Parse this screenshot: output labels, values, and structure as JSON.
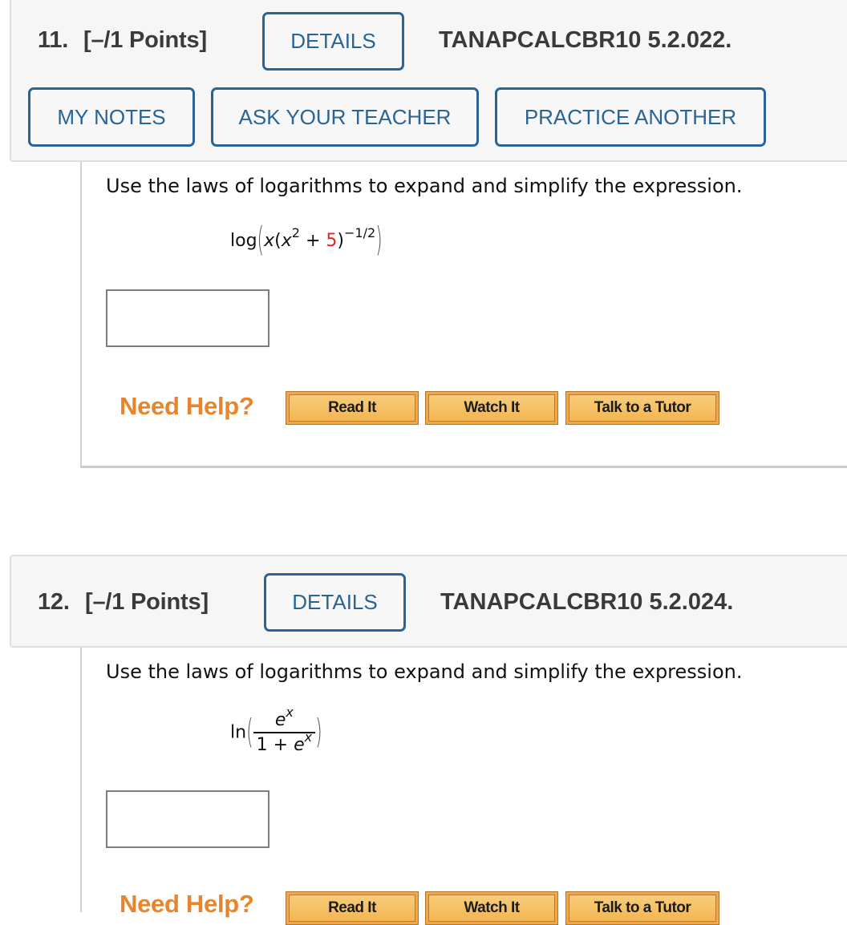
{
  "questions": [
    {
      "number": "11.",
      "points": "[–/1 Points]",
      "details_label": "DETAILS",
      "code": "TANAPCALCBR10 5.2.022.",
      "actions": [
        "MY NOTES",
        "ASK YOUR TEACHER",
        "PRACTICE ANOTHER"
      ],
      "prompt": "Use the laws of logarithms to expand and simplify the expression.",
      "expression": {
        "func": "log",
        "x": "x",
        "open": "(",
        "base": "x",
        "exponent": "2",
        "plus": "+",
        "constant": "5",
        "close": ")",
        "outer_exponent": "−1/2"
      },
      "answer_value": "",
      "help": {
        "label": "Need Help?",
        "buttons": [
          "Read It",
          "Watch It",
          "Talk to a Tutor"
        ]
      }
    },
    {
      "number": "12.",
      "points": "[–/1 Points]",
      "details_label": "DETAILS",
      "code": "TANAPCALCBR10 5.2.024.",
      "prompt": "Use the laws of logarithms to expand and simplify the expression.",
      "expression": {
        "func": "ln",
        "numerator_base": "e",
        "numerator_exp": "x",
        "denominator_one": "1 + ",
        "denominator_base": "e",
        "denominator_exp": "x"
      },
      "answer_value": "",
      "help": {
        "label": "Need Help?",
        "buttons": [
          "Read It",
          "Watch It",
          "Talk to a Tutor"
        ]
      }
    }
  ],
  "colors": {
    "accent_blue": "#2a6496",
    "help_orange": "#e8852c",
    "highlight_red": "#e0261e"
  }
}
